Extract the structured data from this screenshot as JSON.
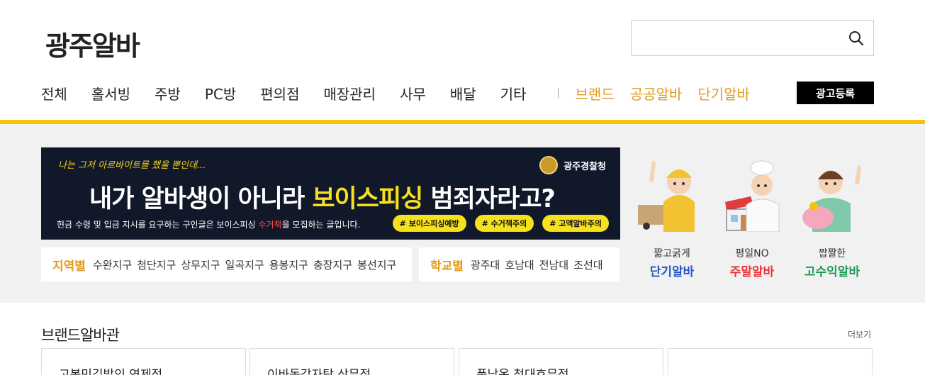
{
  "header": {
    "logo": "광주알바",
    "search_placeholder": "",
    "search_icon": "search-icon"
  },
  "nav": {
    "items": [
      "전체",
      "홀서빙",
      "주방",
      "PC방",
      "편의점",
      "매장관리",
      "사무",
      "배달",
      "기타"
    ],
    "accent_items": [
      "브랜드",
      "공공알바",
      "단기알바"
    ],
    "ad_button": "광고등록",
    "accent_color": "#e39a1c",
    "bar_color": "#f5c20e"
  },
  "banner": {
    "small_text": "나는 그저 아르바이트를 했을 뿐인데...",
    "police": "광주경찰청",
    "title_pre": "내가 알바생이 아니라 ",
    "title_highlight": "보이스피싱",
    "title_post": " 범죄자라고?",
    "desc_pre": "현금 수령 및 입금 지시를 요구하는 구인글은 보이스피싱 ",
    "desc_red": "수거책",
    "desc_post": "을 모집하는 글입니다.",
    "tags": [
      "# 보이스피싱예방",
      "# 수거책주의",
      "# 고액알바주의"
    ]
  },
  "region": {
    "head": "지역별",
    "items": [
      "수완지구",
      "첨단지구",
      "상무지구",
      "일곡지구",
      "용봉지구",
      "충장지구",
      "봉선지구"
    ]
  },
  "school": {
    "head": "학교별",
    "items": [
      "광주대",
      "호남대",
      "전남대",
      "조선대"
    ]
  },
  "promos": [
    {
      "sub": "짧고굵게",
      "main": "단기알바"
    },
    {
      "sub": "평일NO",
      "main": "주말알바"
    },
    {
      "sub": "짭짤한",
      "main": "고수익알바"
    }
  ],
  "brand_section": {
    "title": "브랜드알바관",
    "more": "더보기",
    "cards": [
      "고봉민김밥인 연제점",
      "이바돔감자탕 상무점",
      "풍남옥 첨대호무점",
      ""
    ]
  }
}
